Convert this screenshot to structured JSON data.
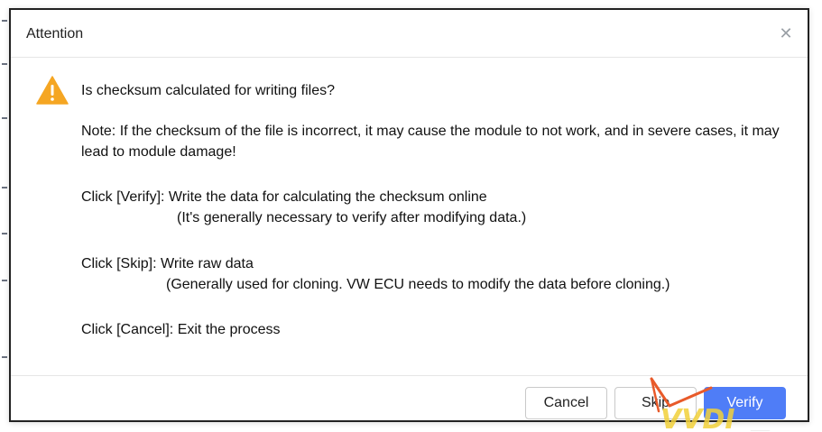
{
  "dialog": {
    "title": "Attention",
    "close_icon": "close-icon",
    "warning_icon": "warning-icon",
    "question": "Is checksum calculated for writing files?",
    "note": "Note: If the checksum of the file is incorrect, it may cause the module to not work, and in severe cases, it may lead to module damage!",
    "verify_line": "Click [Verify]: Write the data for calculating the checksum online",
    "verify_sub": "(It's generally necessary to verify after modifying data.)",
    "skip_line": "Click [Skip]: Write raw data",
    "skip_sub": "(Generally used for cloning. VW ECU needs to modify the data before cloning.)",
    "cancel_line": "Click [Cancel]: Exit the process"
  },
  "buttons": {
    "cancel": "Cancel",
    "skip": "Skip",
    "verify": "Verify"
  },
  "watermark": {
    "text": "VVDI"
  },
  "colors": {
    "accent": "#4f7df7",
    "warning": "#f5a623",
    "watermark": "#f2d13a"
  }
}
